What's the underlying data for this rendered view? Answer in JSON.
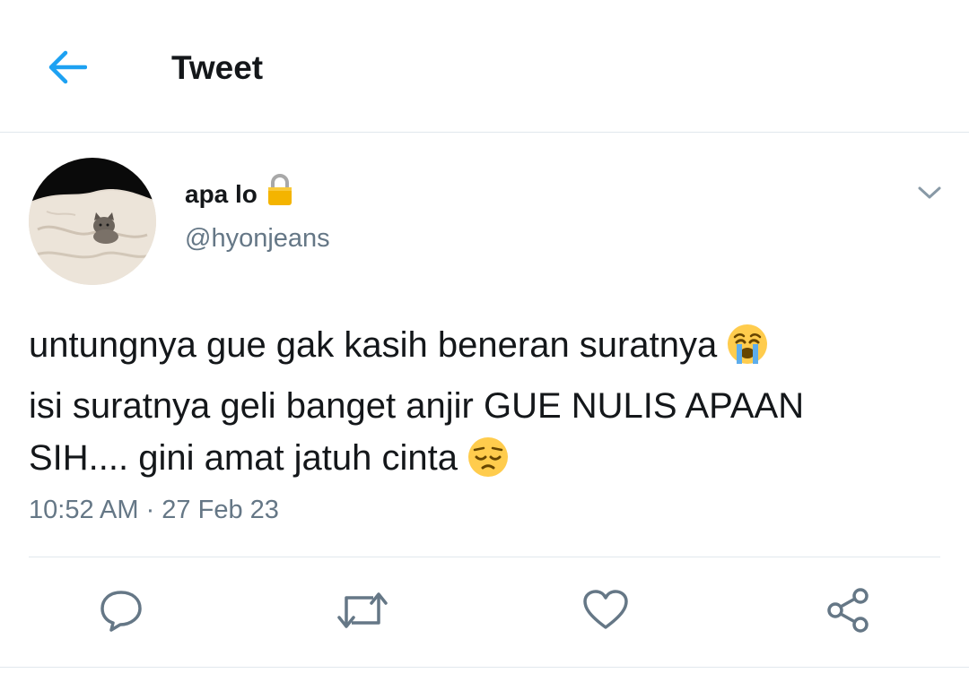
{
  "header": {
    "title": "Tweet",
    "back_icon": "arrow-left-icon"
  },
  "tweet": {
    "author": {
      "display_name": "apa lo",
      "handle": "@hyonjeans",
      "lock_icon": "lock-icon"
    },
    "text_lines": [
      "untungnya gue gak kasih beneran suratnya",
      "isi suratnya geli banget anjir GUE NULIS APAAN",
      "SIH.... gini amat jatuh cinta"
    ],
    "emojis": [
      "loudly-crying-face",
      "pensive-face"
    ],
    "timestamp": "10:52 AM · 27 Feb 23"
  },
  "actions": [
    "reply-icon",
    "retweet-icon",
    "like-icon",
    "share-icon"
  ],
  "colors": {
    "accent": "#1da1f2",
    "text": "#14171a",
    "secondary": "#657786",
    "border": "#e1e8ed",
    "lock": "#f4b400"
  }
}
